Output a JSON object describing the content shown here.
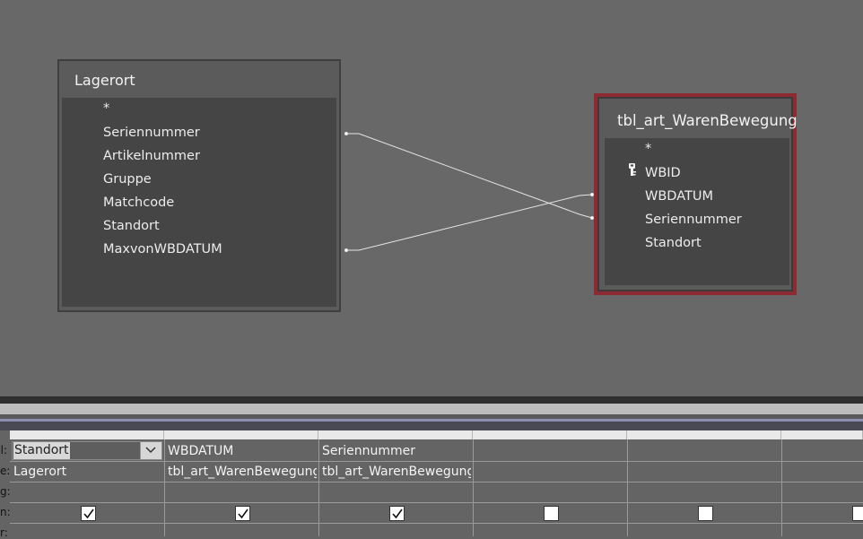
{
  "design": {
    "tables": [
      {
        "title": "Lagerort",
        "fields": [
          "*",
          "Seriennummer",
          "Artikelnummer",
          "Gruppe",
          "Matchcode",
          "Standort",
          "MaxvonWBDATUM"
        ]
      },
      {
        "title": "tbl_art_WarenBewegung",
        "fields": [
          "*",
          "WBID",
          "WBDATUM",
          "Seriennummer",
          "Standort"
        ],
        "primary_key_field": "WBID",
        "key_icon": "key-icon"
      }
    ]
  },
  "grid": {
    "row_labels": [
      "l:",
      "e:",
      "g:",
      "n:",
      "r:"
    ],
    "columns": [
      {
        "field": "Standort",
        "table": "Lagerort",
        "show": true,
        "selected": true
      },
      {
        "field": "WBDATUM",
        "table": "tbl_art_WarenBewegung",
        "show": true
      },
      {
        "field": "Seriennummer",
        "table": "tbl_art_WarenBewegung",
        "show": true
      },
      {
        "field": "",
        "table": "",
        "show": false
      },
      {
        "field": "",
        "table": "",
        "show": false
      },
      {
        "field": "",
        "table": "",
        "show": false
      }
    ],
    "dropdown_icon": "chevron-down-icon"
  },
  "colors": {
    "selected_table_border": "#8e2a31",
    "canvas": "#686868"
  }
}
